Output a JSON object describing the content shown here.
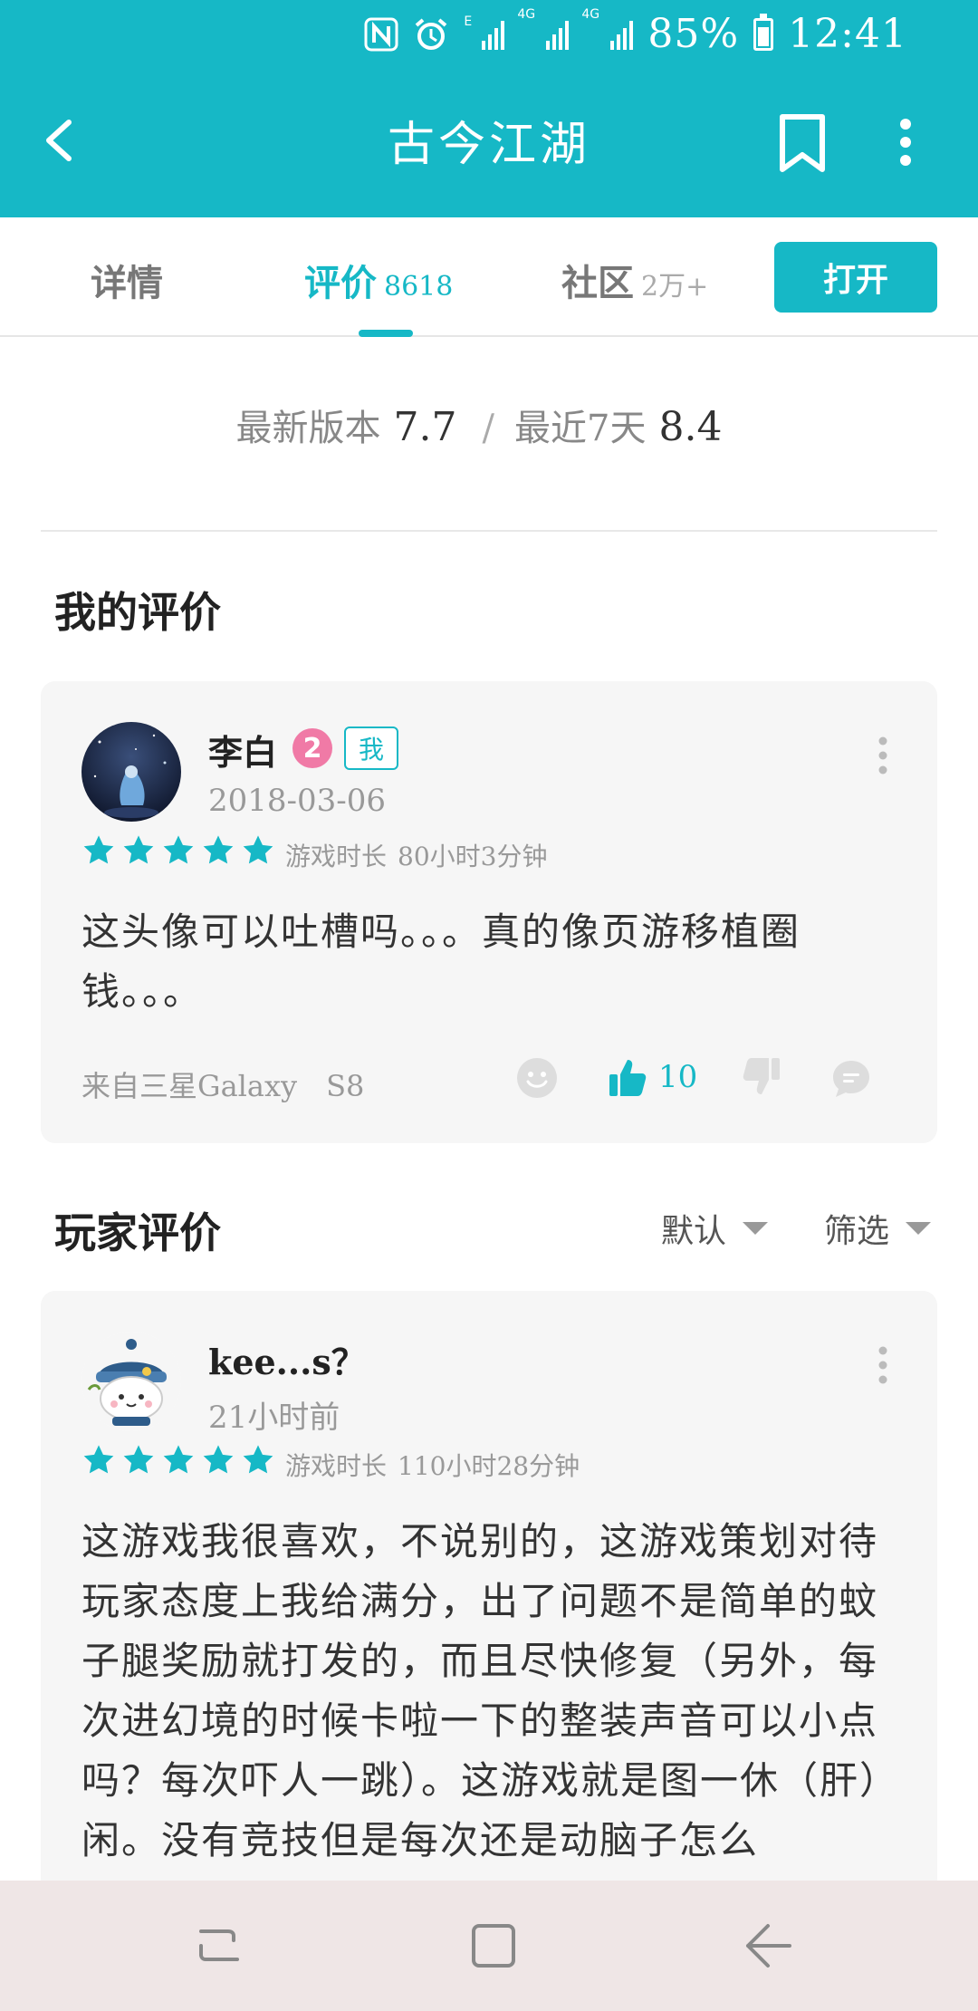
{
  "status_bar": {
    "battery": "85%",
    "time": "12:41",
    "icons": [
      "nfc-icon",
      "alarm-icon",
      "signal-e-icon",
      "signal-4g-icon",
      "signal-4g-2g-icon",
      "battery-icon"
    ],
    "net1": "E",
    "net2": "4G",
    "net3": "4G"
  },
  "app_bar": {
    "title": "古今江湖",
    "icons": [
      "back-arrow-icon",
      "bookmark-icon",
      "more-vertical-icon"
    ]
  },
  "tabs": [
    {
      "label": "详情",
      "count": ""
    },
    {
      "label": "评价",
      "count": "8618"
    },
    {
      "label": "社区",
      "count": "2万+"
    }
  ],
  "open_button": "打开",
  "ratings": {
    "latest_label": "最新版本",
    "latest_value": "7.7",
    "separator": "/",
    "recent_label": "最近7天",
    "recent_value": "8.4"
  },
  "my_review": {
    "section_title": "我的评价",
    "user_name": "李白",
    "level": "2",
    "me_tag": "我",
    "date": "2018-03-06",
    "stars": 5,
    "playtime_label": "游戏时长",
    "playtime_value": "80小时3分钟",
    "text": "这头像可以吐槽吗。。。真的像页游移植圈钱。。。",
    "device": "来自三星Galaxy　S8",
    "like_count": "10"
  },
  "player_reviews": {
    "section_title": "玩家评价",
    "sort_label": "默认",
    "filter_label": "筛选",
    "items": [
      {
        "user_name": "kee...s？",
        "date": "21小时前",
        "stars": 5,
        "playtime_label": "游戏时长",
        "playtime_value": "110小时28分钟",
        "text": "这游戏我很喜欢，不说别的，这游戏策划对待玩家态度上我给满分，出了问题不是简单的蚊子腿奖励就打发的，而且尽快修复（另外，每次进幻境的时候卡啦一下的整装声音可以小点吗？每次吓人一跳）。这游戏就是图一休（肝）闲。没有竞技但是每次还是动脑子怎么"
      }
    ]
  },
  "nav_bar": {
    "icons": [
      "recent-apps-icon",
      "home-icon",
      "back-nav-icon"
    ]
  },
  "colors": {
    "accent": "#16b8c6",
    "star": "#16b8c6",
    "level_badge": "#f07aa6",
    "card_bg": "#f6f6f6",
    "nav_bg": "#efe6e6"
  }
}
